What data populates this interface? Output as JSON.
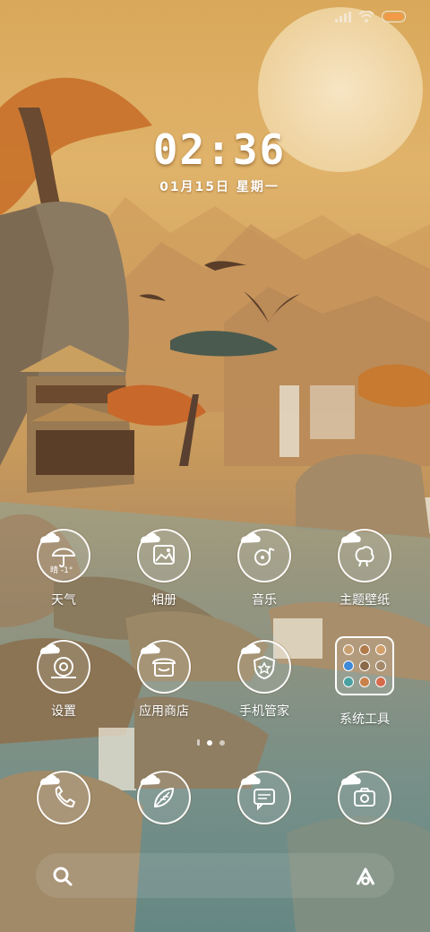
{
  "status_bar": {
    "icons": [
      "signal-icon",
      "wifi-icon",
      "battery-icon"
    ]
  },
  "clock": {
    "time": "02:36",
    "date": "01月15日 星期一"
  },
  "weather": {
    "temp": "晴 -1°"
  },
  "apps": {
    "row1": [
      {
        "label": "天气",
        "icon": "weather-umbrella-icon"
      },
      {
        "label": "相册",
        "icon": "gallery-icon"
      },
      {
        "label": "音乐",
        "icon": "music-icon"
      },
      {
        "label": "主题壁纸",
        "icon": "theme-icon"
      }
    ],
    "row2": [
      {
        "label": "设置",
        "icon": "settings-icon"
      },
      {
        "label": "应用商店",
        "icon": "app-store-icon"
      },
      {
        "label": "手机管家",
        "icon": "security-shield-icon"
      },
      {
        "label": "系统工具",
        "icon": "folder-icon"
      }
    ]
  },
  "dock": {
    "apps": [
      "phone-icon",
      "browser-icon",
      "messages-icon",
      "camera-icon"
    ],
    "search_icon": "search-icon",
    "assistant_icon": "assistant-icon"
  },
  "colors": {
    "sky": "#d9a85a",
    "water": "#6f8d8a",
    "icon_stroke": "#ffffff"
  }
}
